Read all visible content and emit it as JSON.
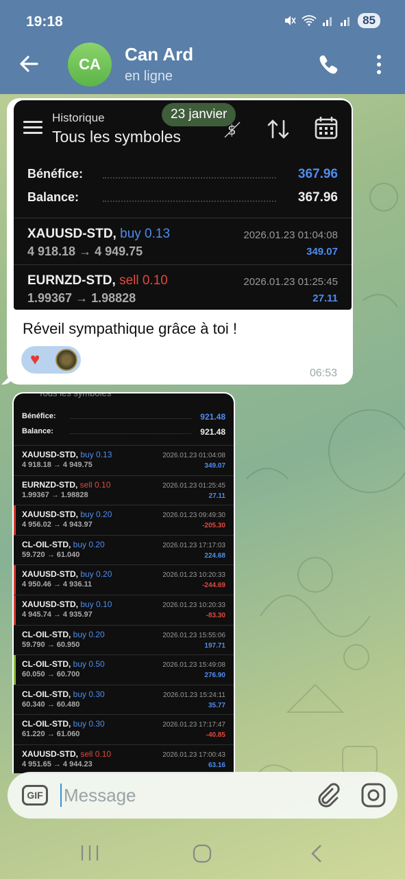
{
  "status_bar": {
    "time": "19:18",
    "battery": "85"
  },
  "header": {
    "avatar_initials": "CA",
    "name": "Can Ard",
    "status": "en ligne"
  },
  "date_chip": "23 janvier",
  "message1": {
    "screenshot": {
      "title_small": "Historique",
      "title_main": "Tous les symboles",
      "profit_label": "Bénéfice:",
      "profit_value": "367.96",
      "balance_label": "Balance:",
      "balance_value": "367.96",
      "trades": [
        {
          "symbol": "XAUUSD-STD,",
          "side": "buy 0.13",
          "prices": "4 918.18 → 4 949.75",
          "datetime": "2026.01.23 01:04:08",
          "pl": "349.07"
        },
        {
          "symbol": "EURNZD-STD,",
          "side": "sell 0.10",
          "prices": "1.99367 → 1.98828",
          "datetime": "2026.01.23 01:25:45",
          "pl": "27.11"
        }
      ]
    },
    "text": "Réveil sympathique grâce à toi !",
    "reaction_heart": "♥",
    "time": "06:53"
  },
  "message2": {
    "screenshot": {
      "cut_title": "Tous les symboles",
      "profit_label": "Bénéfice:",
      "profit_value": "921.48",
      "balance_label": "Balance:",
      "balance_value": "921.48",
      "trades": [
        {
          "symbol": "XAUUSD-STD,",
          "side": "buy 0.13",
          "side_type": "buy",
          "prices": "4 918.18 → 4 949.75",
          "datetime": "2026.01.23 01:04:08",
          "pl": "349.07",
          "pl_type": "pos",
          "bar": ""
        },
        {
          "symbol": "EURNZD-STD,",
          "side": "sell 0.10",
          "side_type": "sell",
          "prices": "1.99367 → 1.98828",
          "datetime": "2026.01.23 01:25:45",
          "pl": "27.11",
          "pl_type": "pos",
          "bar": ""
        },
        {
          "symbol": "XAUUSD-STD,",
          "side": "buy 0.20",
          "side_type": "buy",
          "prices": "4 956.02 → 4 943.97",
          "datetime": "2026.01.23 09:49:30",
          "pl": "-205.30",
          "pl_type": "neg",
          "bar": "#d13a32"
        },
        {
          "symbol": "CL-OIL-STD,",
          "side": "buy 0.20",
          "side_type": "buy",
          "prices": "59.720 → 61.040",
          "datetime": "2026.01.23 17:17:03",
          "pl": "224.68",
          "pl_type": "pos",
          "bar": ""
        },
        {
          "symbol": "XAUUSD-STD,",
          "side": "buy 0.20",
          "side_type": "buy",
          "prices": "4 950.46 → 4 936.11",
          "datetime": "2026.01.23 10:20:33",
          "pl": "-244.69",
          "pl_type": "neg",
          "bar": "#d13a32"
        },
        {
          "symbol": "XAUUSD-STD,",
          "side": "buy 0.10",
          "side_type": "buy",
          "prices": "4 945.74 → 4 935.97",
          "datetime": "2026.01.23 10:20:33",
          "pl": "-83.30",
          "pl_type": "neg",
          "bar": "#d13a32"
        },
        {
          "symbol": "CL-OIL-STD,",
          "side": "buy 0.20",
          "side_type": "buy",
          "prices": "59.790 → 60.950",
          "datetime": "2026.01.23 15:55:06",
          "pl": "197.71",
          "pl_type": "pos",
          "bar": ""
        },
        {
          "symbol": "CL-OIL-STD,",
          "side": "buy 0.50",
          "side_type": "buy",
          "prices": "60.050 → 60.700",
          "datetime": "2026.01.23 15:49:08",
          "pl": "276.90",
          "pl_type": "pos",
          "bar": "#8ab83a"
        },
        {
          "symbol": "CL-OIL-STD,",
          "side": "buy 0.30",
          "side_type": "buy",
          "prices": "60.340 → 60.480",
          "datetime": "2026.01.23 15:24:11",
          "pl": "35.77",
          "pl_type": "pos",
          "bar": ""
        },
        {
          "symbol": "CL-OIL-STD,",
          "side": "buy 0.30",
          "side_type": "buy",
          "prices": "61.220 → 61.060",
          "datetime": "2026.01.23 17:17:47",
          "pl": "-40.85",
          "pl_type": "neg",
          "bar": ""
        },
        {
          "symbol": "XAUUSD-STD,",
          "side": "sell 0.10",
          "side_type": "sell",
          "prices": "4 951.65 → 4 944.23",
          "datetime": "2026.01.23 17:00:43",
          "pl": "63.16",
          "pl_type": "pos",
          "bar": ""
        }
      ]
    }
  },
  "composer": {
    "gif_label": "GIF",
    "placeholder": "Message"
  },
  "icons": {
    "back": "arrow-left-icon",
    "call": "phone-icon",
    "more": "more-vert-icon",
    "gif": "gif-icon",
    "attach": "paperclip-icon",
    "camera": "instagram-camera-icon"
  },
  "colors": {
    "header": "#5a7fa8",
    "buy": "#4e8cf0",
    "sell": "#e2483e"
  }
}
